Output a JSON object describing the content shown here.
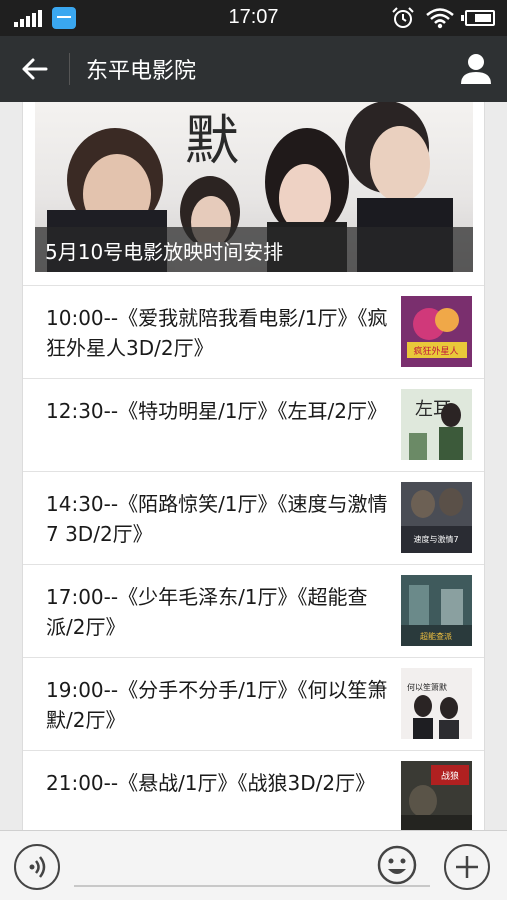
{
  "status_bar": {
    "time": "17:07",
    "icons": [
      "signal-icon",
      "app-notification-icon",
      "alarm-icon",
      "wifi-icon",
      "battery-icon"
    ]
  },
  "header": {
    "title": "东平电影院",
    "back_icon": "arrow-left-icon",
    "profile_icon": "person-icon"
  },
  "banner": {
    "caption": "5月10号电影放映时间安排",
    "poster_text": "默"
  },
  "schedule": [
    {
      "text": "10:00--《爱我就陪我看电影/1厅》《疯狂外星人3D/2厅》",
      "thumb_label": "疯狂外星人"
    },
    {
      "text": "12:30--《特功明星/1厅》《左耳/2厅》",
      "thumb_label": "左耳"
    },
    {
      "text": "14:30--《陌路惊笑/1厅》《速度与激情7 3D/2厅》",
      "thumb_label": "速度与激情7"
    },
    {
      "text": "17:00--《少年毛泽东/1厅》《超能查派/2厅》",
      "thumb_label": "超能查派"
    },
    {
      "text": "19:00--《分手不分手/1厅》《何以笙箫默/2厅》",
      "thumb_label": "何以笙箫默"
    },
    {
      "text": "21:00--《悬战/1厅》《战狼3D/2厅》",
      "thumb_label": "战狼"
    }
  ],
  "input_bar": {
    "voice_icon": "voice-icon",
    "emoji_icon": "emoji-icon",
    "plus_icon": "plus-icon"
  },
  "colors": {
    "title_bar": "#2e3133",
    "status_bar": "#1f1f1f",
    "background": "#ebebeb"
  }
}
